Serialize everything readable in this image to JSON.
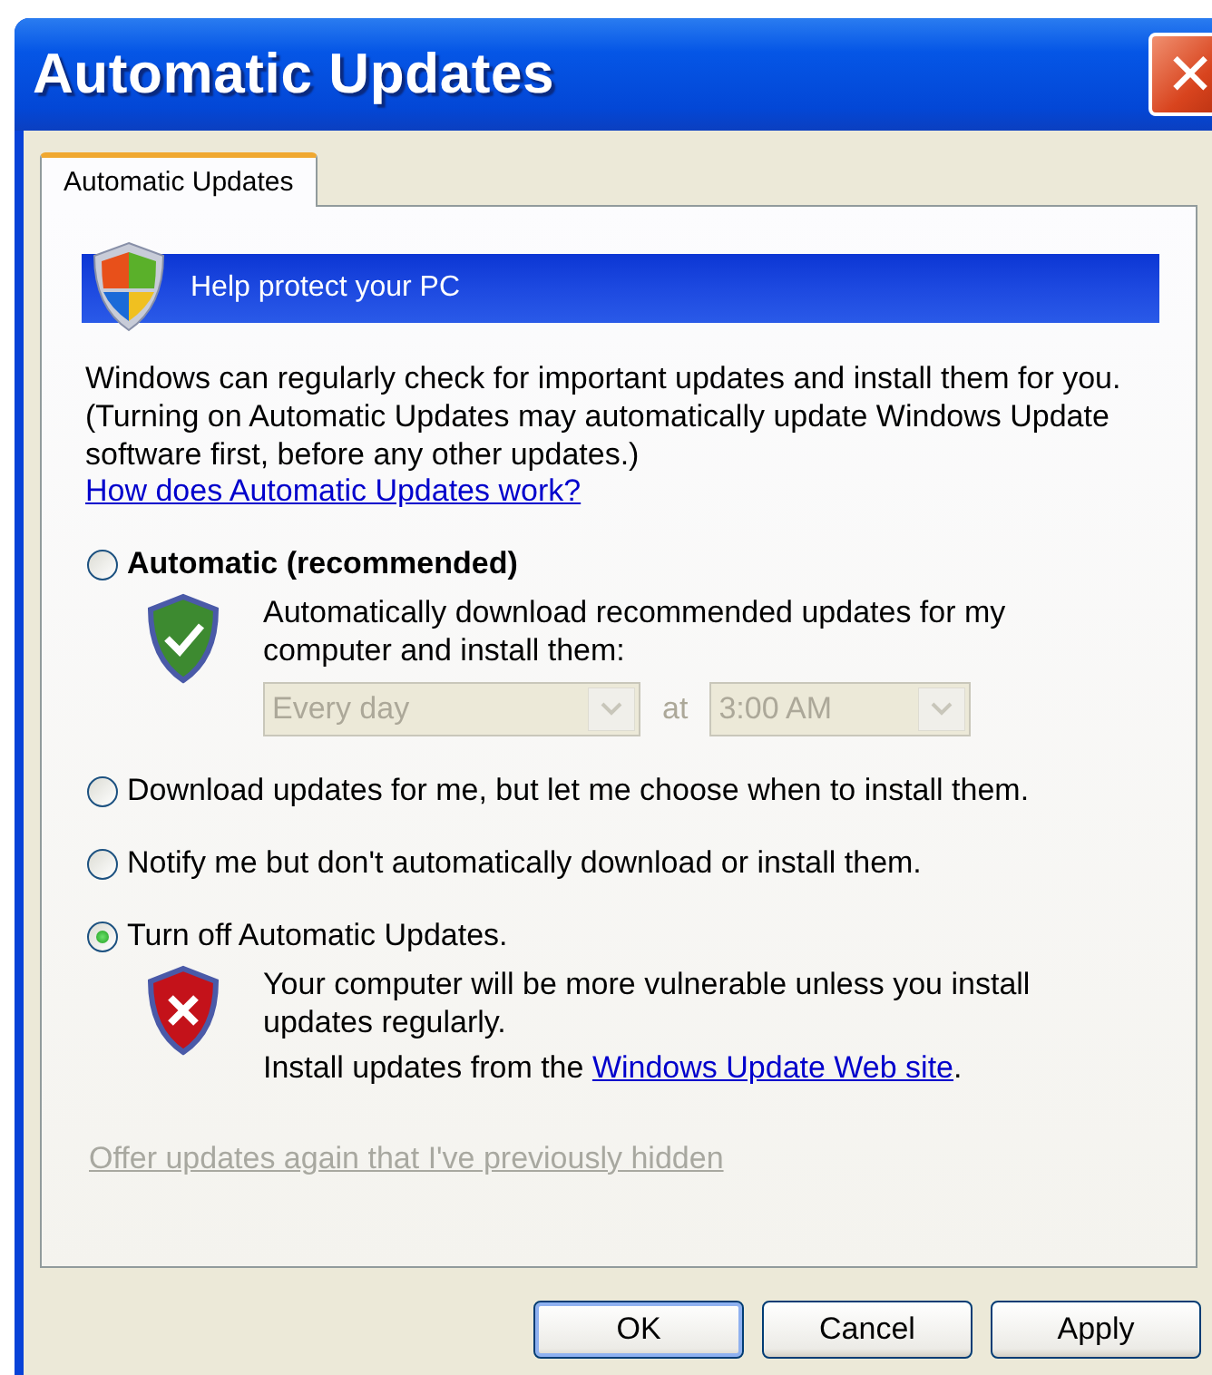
{
  "window": {
    "title": "Automatic Updates",
    "close": "✕"
  },
  "tabs": [
    {
      "label": "Automatic Updates",
      "selected": true
    }
  ],
  "banner": {
    "title": "Help protect your PC"
  },
  "intro": "Windows can regularly check for important updates and install them for you. (Turning on Automatic Updates may automatically update Windows Update software first, before any other updates.)",
  "intro_link": "How does Automatic Updates work?",
  "options": [
    {
      "kind": "schedule",
      "label": "Automatic (recommended)",
      "bold": true,
      "selected": false,
      "description": "Automatically download recommended updates for my computer and install them:",
      "frequency": {
        "value": "Every day",
        "disabled": true
      },
      "at": "at",
      "time": {
        "value": "3:00 AM",
        "disabled": true
      }
    },
    {
      "kind": "plain",
      "label": "Download updates for me, but let me choose when to install them.",
      "bold": false,
      "selected": false
    },
    {
      "kind": "plain",
      "label": "Notify me but don't automatically download or install them.",
      "bold": false,
      "selected": false
    },
    {
      "kind": "warning",
      "label": "Turn off Automatic Updates.",
      "bold": false,
      "selected": true,
      "description": "Your computer will be more vulnerable unless you install updates regularly.",
      "install_text": "Install updates from the",
      "link": "Windows Update Web site",
      "link_end": "."
    }
  ],
  "hidden_link": {
    "label": "Offer updates again that I've previously hidden",
    "disabled": true
  },
  "buttons": [
    {
      "label": "OK",
      "default": true
    },
    {
      "label": "Cancel",
      "default": false
    },
    {
      "label": "Apply",
      "default": false
    }
  ]
}
